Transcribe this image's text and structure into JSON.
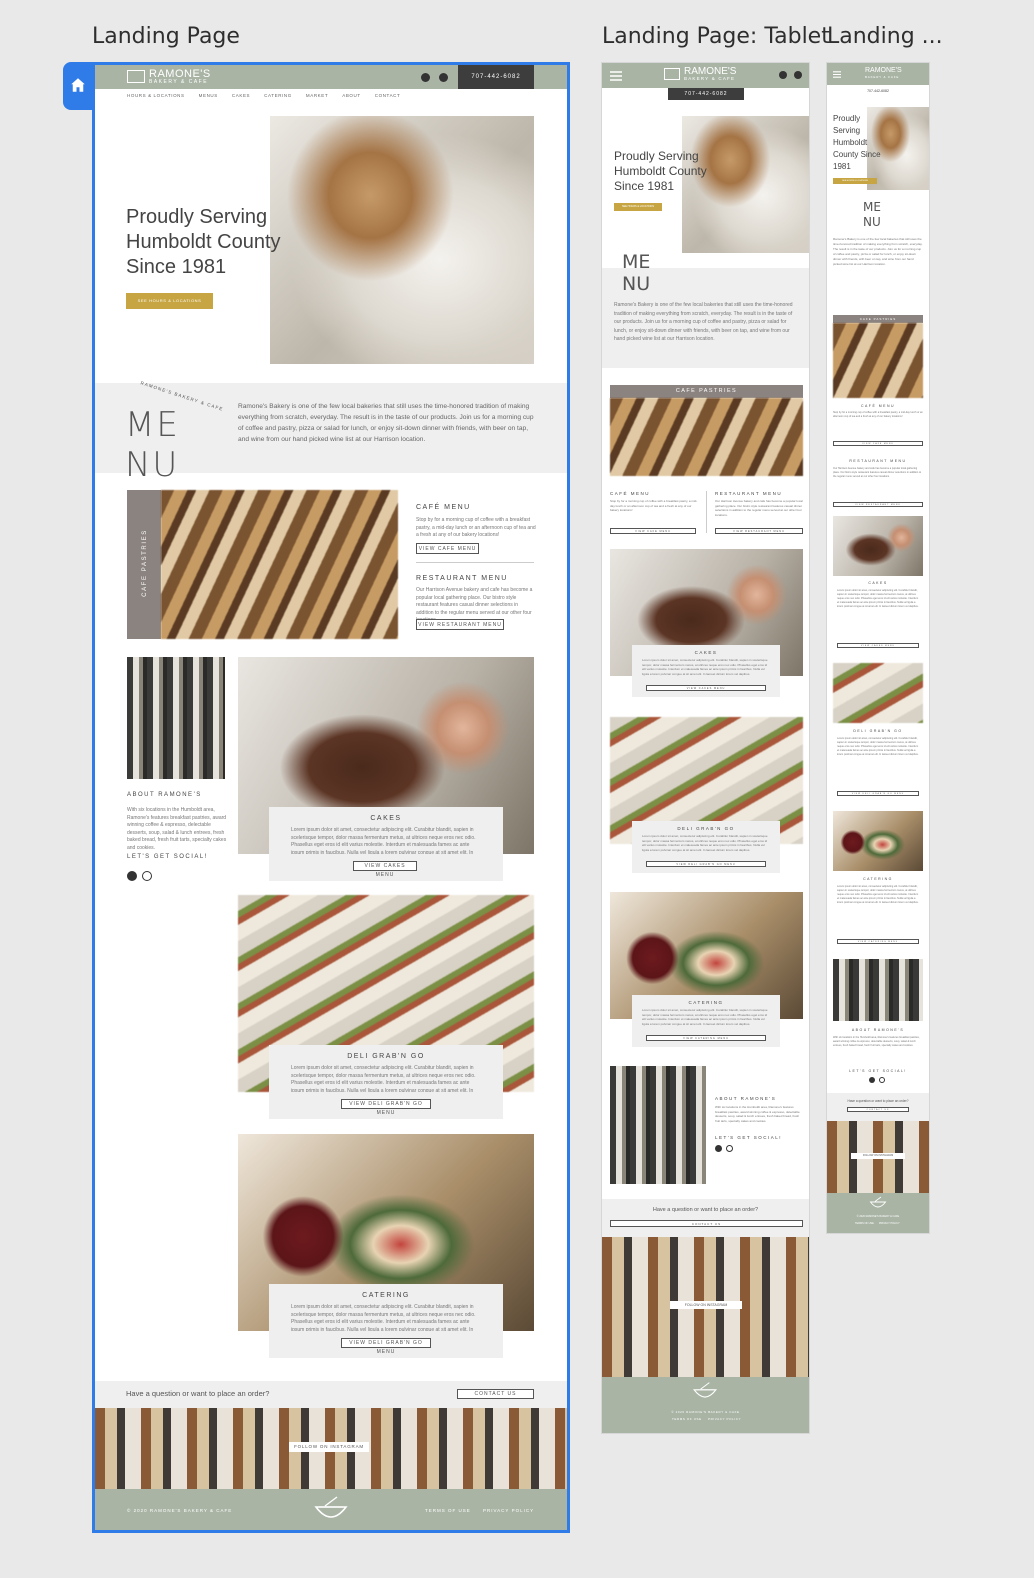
{
  "artboards": {
    "desktop_title": "Landing Page",
    "tablet_title": "Landing Page: Tablet",
    "mobile_title": "Landing ..."
  },
  "site": {
    "brand_name": "RAMONE'S",
    "brand_sub": "BAKERY & CAFE",
    "phone": "707-442-6082",
    "nav": [
      "HOURS & LOCATIONS",
      "MENUS",
      "CAKES",
      "CATERING",
      "MARKET",
      "ABOUT",
      "CONTACT"
    ],
    "hero_title": "Proudly Serving Humboldt County Since 1981",
    "hero_button": "SEE HOURS & LOCATIONS",
    "menu_logo_top": "ME",
    "menu_logo_bottom": "NU",
    "menu_arc_text": "RAMONE'S BAKERY & CAFE",
    "intro": "Ramone's Bakery is one of the few local bakeries that still uses the time-honored tradition of making everything from scratch, everyday. The result is in the taste of our products. Join us for a morning cup of coffee and pastry, pizza or salad for lunch, or enjoy sit-down dinner with friends, with beer on tap, and wine from our hand picked wine list at our Harrison location.",
    "cafe_pastries": "CAFE PASTRIES",
    "cafe_menu_title": "CAFÉ MENU",
    "cafe_menu_text": "Stop by for a morning cup of coffee with a breakfast pastry, a mid-day lunch or an afternoon cup of tea and a fresh at any of our bakery locations!",
    "cafe_menu_button": "VIEW CAFE MENU",
    "restaurant_menu_title": "RESTAURANT MENU",
    "restaurant_menu_text": "Our Harrison Avenue bakery and cafe has become a popular local gathering place. Our bistro style restaurant features casual dinner selections in addition to the regular menu served at our other four locations.",
    "restaurant_menu_button": "VIEW RESTAURANT MENU",
    "about_title": "ABOUT RAMONE'S",
    "about_text": "With six locations in the Humboldt area, Ramone's features breakfast pastries, award winning coffee & espresso, delectable desserts, soup, salad & lunch entrees, fresh baked bread, fresh fruit tarts, specialty cakes and cookies.",
    "social_title": "LET'S GET SOCIAL!",
    "lorem": "Lorem ipsum dolor sit amet, consectetur adipiscing elit. Curabitur blandit, sapien in scelerisque tempor, dolor massa fermentum metus, at ultrices neque eros nec odio. Phasellus eget eros id elit varius molestie. Interdum et malesuada fames ac ante ipsum primis in faucibus. Nulla vel ligula a lorem pulvinar congue at sit amet elit. In laoreet dictum lorem vel dapibus.",
    "cakes_title": "CAKES",
    "cakes_button": "VIEW CAKES MENU",
    "deli_title": "DELI GRAB'N GO",
    "deli_button": "VIEW DELI GRAB'N GO MENU",
    "catering_title": "CATERING",
    "catering_button_desktop": "VIEW DELI GRAB'N GO MENU",
    "catering_button": "VIEW CATERING MENU",
    "question": "Have a question or want to place an order?",
    "contact_button": "CONTACT US",
    "instagram_button": "FOLLOW ON INSTAGRAM",
    "copyright": "© 2020 RAMONE'S BAKERY & CAFE",
    "terms": "TERMS OF USE",
    "privacy": "PRIVACY POLICY"
  },
  "icons": {
    "home": "home-icon",
    "facebook": "facebook-icon",
    "instagram": "instagram-icon",
    "hamburger": "hamburger-menu-icon",
    "bowl": "mixing-bowl-logo-icon"
  },
  "colors": {
    "selection_blue": "#2f7be8",
    "sage": "#a9b4a5",
    "mustard": "#c6a542",
    "dark_gray": "#3d3d3d"
  }
}
